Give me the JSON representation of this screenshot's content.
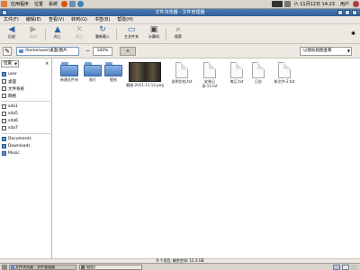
{
  "top_panel": {
    "menus": [
      "应用程序",
      "位置",
      "系统"
    ],
    "clock": "六 11月12日 14:23",
    "user": "用户"
  },
  "window": {
    "title": "文件浏览器 - 文件管理器",
    "menus": [
      "文件(F)",
      "编辑(E)",
      "查看(V)",
      "转到(G)",
      "书签(B)",
      "帮助(H)"
    ]
  },
  "toolbar": {
    "back": "后退",
    "forward": "前进",
    "up": "向上",
    "stop": "停止",
    "reload": "重新载入",
    "home": "主文件夹",
    "computer": "计算机",
    "search": "搜索"
  },
  "location": {
    "path": "/home/user/桌面/图片",
    "zoom": "100%",
    "view_mode": "以图标视图查看"
  },
  "sidebar": {
    "header": "位置",
    "items": [
      {
        "label": "user",
        "icon": "home-icon"
      },
      {
        "label": "桌面",
        "icon": "desktop-icon"
      },
      {
        "label": "文件系统",
        "icon": "drive-icon"
      },
      {
        "label": "网络",
        "icon": "network-icon"
      },
      {
        "label": "sda1",
        "icon": "drive-icon"
      },
      {
        "label": "sda5",
        "icon": "drive-icon"
      },
      {
        "label": "sda6",
        "icon": "drive-icon"
      },
      {
        "label": "sda7",
        "icon": "drive-icon"
      },
      {
        "label": "Documents",
        "icon": "folder-icon"
      },
      {
        "label": "Downloads",
        "icon": "folder-icon"
      },
      {
        "label": "Music",
        "icon": "folder-icon"
      }
    ]
  },
  "files": [
    {
      "name": "新建文件夹",
      "kind": "folder"
    },
    {
      "name": "照片",
      "kind": "folder"
    },
    {
      "name": "壁纸",
      "kind": "folder"
    },
    {
      "name": "截图-2011-11-12.png",
      "kind": "image"
    },
    {
      "name": "说明文档.txt",
      "kind": "document"
    },
    {
      "name": "安装记录-11.txt",
      "kind": "document"
    },
    {
      "name": "笔记.txt",
      "kind": "document"
    },
    {
      "name": "日志",
      "kind": "document"
    },
    {
      "name": "新文件-2.txt",
      "kind": "document"
    }
  ],
  "status": "9 个项目, 剩余空间: 12.3 GB",
  "taskbar": {
    "tasks": [
      "文件浏览器 - 文件管理器",
      "[截图]"
    ]
  },
  "colors": {
    "title_bar": "#2f5d97",
    "folder": "#5b8fd1",
    "panel": "#d8d4cc",
    "window_bg": "#ece9e2"
  }
}
